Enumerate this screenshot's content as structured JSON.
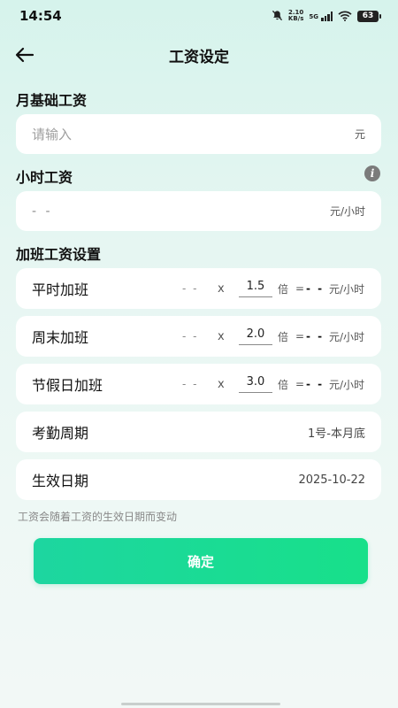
{
  "status_bar": {
    "time": "14:54",
    "net_speed_value": "2.10",
    "net_speed_unit": "KB/s",
    "network_type": "5G",
    "battery": "63"
  },
  "header": {
    "title": "工资设定"
  },
  "monthly_base": {
    "label": "月基础工资",
    "placeholder": "请输入",
    "unit": "元"
  },
  "hourly": {
    "label": "小时工资",
    "value": "- -",
    "unit": "元/小时"
  },
  "overtime": {
    "label": "加班工资设置",
    "times_symbol": "x",
    "multiplier_unit": "倍",
    "equals": "=",
    "result_unit": "元/小时",
    "rows": [
      {
        "title": "平时加班",
        "base": "- -",
        "multiplier": "1.5",
        "result": "- -"
      },
      {
        "title": "周末加班",
        "base": "- -",
        "multiplier": "2.0",
        "result": "- -"
      },
      {
        "title": "节假日加班",
        "base": "- -",
        "multiplier": "3.0",
        "result": "- -"
      }
    ]
  },
  "attendance": {
    "title": "考勤周期",
    "value": "1号-本月底"
  },
  "effective": {
    "title": "生效日期",
    "value": "2025-10-22"
  },
  "note": "工资会随着工资的生效日期而变动",
  "confirm_label": "确定",
  "colors": {
    "accent_start": "#1dd6a0",
    "accent_end": "#18e08a",
    "background_top": "#d6f3ec"
  }
}
